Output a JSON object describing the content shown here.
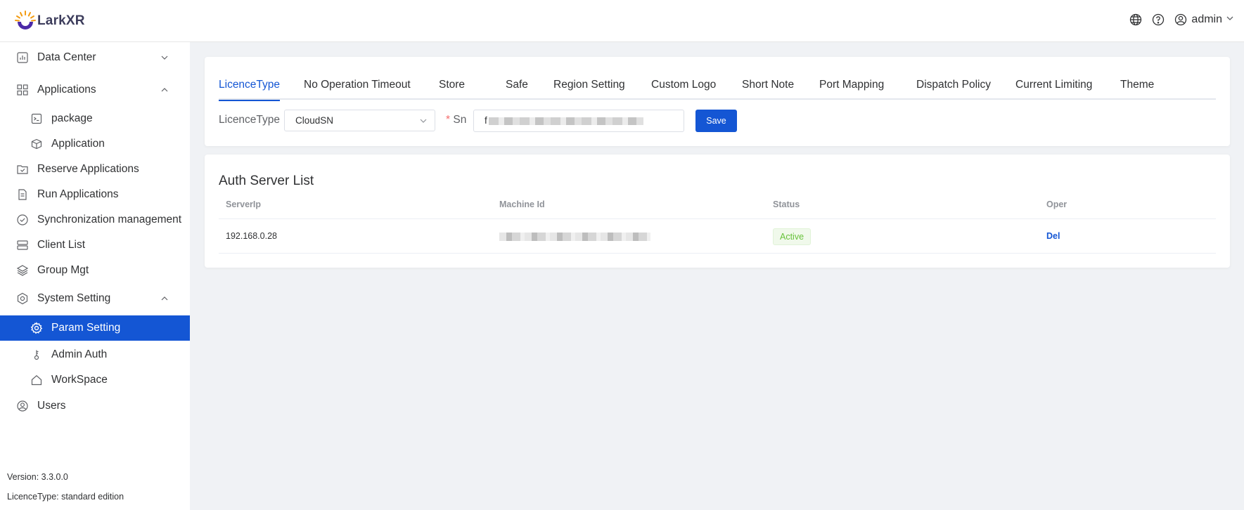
{
  "brand": {
    "name": "LarkXR",
    "color": "#1456d4"
  },
  "header": {
    "user": "admin",
    "icons": [
      "globe-icon",
      "help-icon",
      "user-icon",
      "chevron-down-icon"
    ]
  },
  "sidebar": {
    "items": [
      {
        "label": "Data Center",
        "icon": "bar-chart-icon"
      },
      {
        "label": "Applications",
        "icon": "grid-icon"
      },
      {
        "label": "package",
        "icon": "terminal-icon"
      },
      {
        "label": "Application",
        "icon": "box-icon"
      },
      {
        "label": "Reserve Applications",
        "icon": "folder-check-icon"
      },
      {
        "label": "Run Applications",
        "icon": "document-icon"
      },
      {
        "label": "Synchronization management",
        "icon": "check-circle-icon"
      },
      {
        "label": "Client List",
        "icon": "server-icon"
      },
      {
        "label": "Group Mgt",
        "icon": "layers-icon"
      },
      {
        "label": "System Setting",
        "icon": "settings-icon"
      },
      {
        "label": "Param Setting",
        "icon": "gear-icon"
      },
      {
        "label": "Admin Auth",
        "icon": "key-icon"
      },
      {
        "label": "WorkSpace",
        "icon": "home-icon"
      },
      {
        "label": "Users",
        "icon": "user-circle-icon"
      }
    ],
    "version": "Version: 3.3.0.0",
    "licence": "LicenceType: standard edition"
  },
  "tabs": [
    "LicenceType",
    "No Operation Timeout",
    "Store",
    "Safe",
    "Region Setting",
    "Custom Logo",
    "Short Note",
    "Port Mapping",
    "Dispatch Policy",
    "Current Limiting",
    "Theme"
  ],
  "form": {
    "licence_label": "LicenceType",
    "licence_value": "CloudSN",
    "sn_required": "*",
    "sn_label": "Sn",
    "sn_value_visible": "f",
    "save_label": "Save"
  },
  "auth_list": {
    "title": "Auth Server List",
    "columns": [
      "ServerIp",
      "Machine Id",
      "Status",
      "Oper"
    ],
    "rows": [
      {
        "server_ip": "192.168.0.28",
        "status": "Active",
        "oper": "Del"
      }
    ]
  }
}
